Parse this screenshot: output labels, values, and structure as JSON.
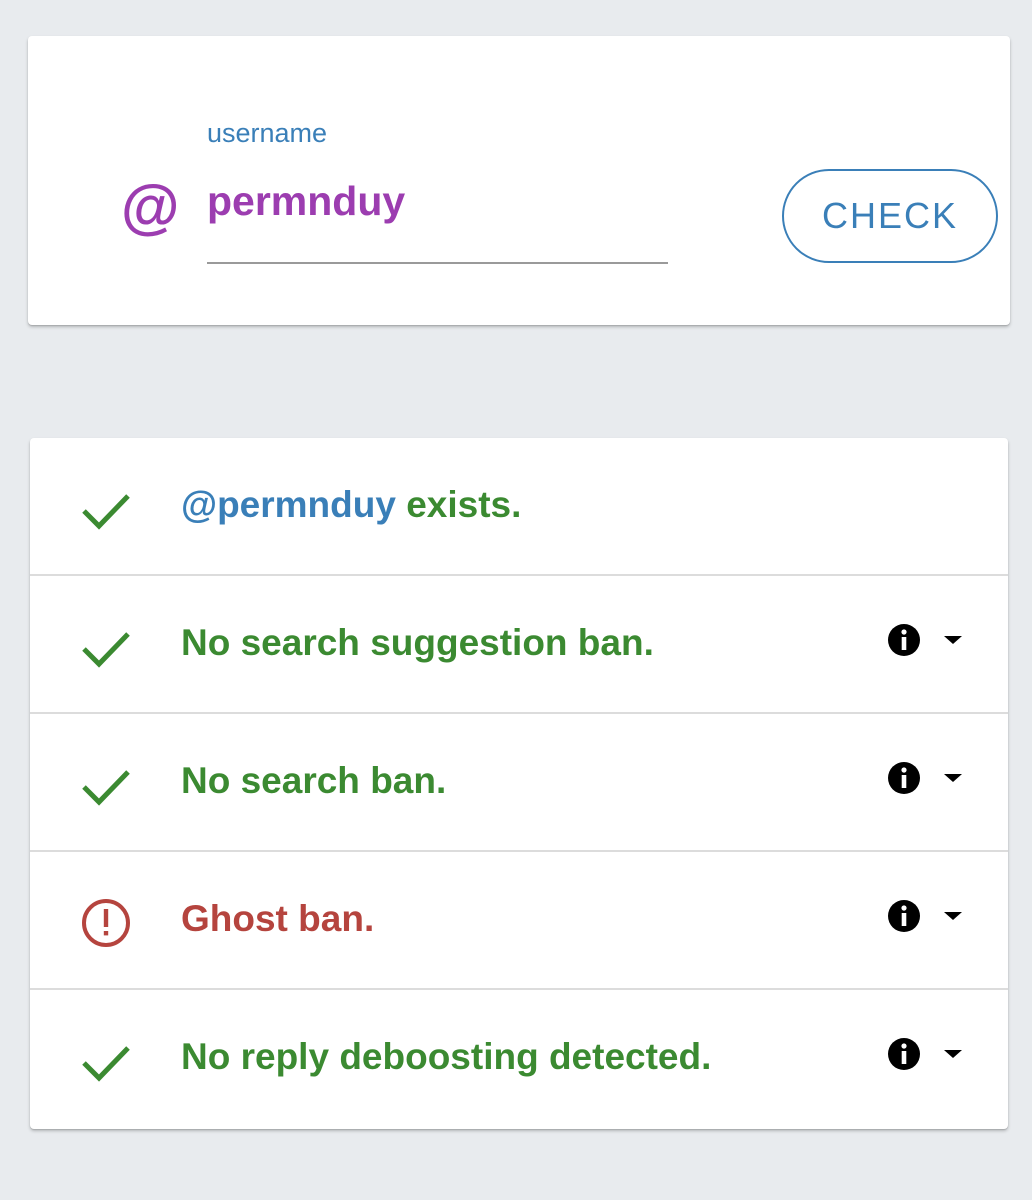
{
  "search": {
    "label": "username",
    "value": "permnduy",
    "check_label": "CHECK",
    "at_symbol": "@"
  },
  "results": [
    {
      "handle": "@permnduy",
      "suffix": " exists.",
      "status": "ok",
      "has_actions": false
    },
    {
      "text": "No search suggestion ban.",
      "status": "ok",
      "has_actions": true
    },
    {
      "text": "No search ban.",
      "status": "ok",
      "has_actions": true
    },
    {
      "text": "Ghost ban.",
      "status": "warning",
      "has_actions": true
    },
    {
      "text": "No reply deboosting detected.",
      "status": "ok",
      "has_actions": true
    }
  ],
  "colors": {
    "ok": "#3b8a31",
    "warning": "#b5443e",
    "accent": "#3a7fb8",
    "brand": "#9c3db0"
  },
  "icons": {
    "ok": "check-icon",
    "warning": "alert-circle-icon",
    "info": "info-icon",
    "expand": "caret-down-icon"
  }
}
